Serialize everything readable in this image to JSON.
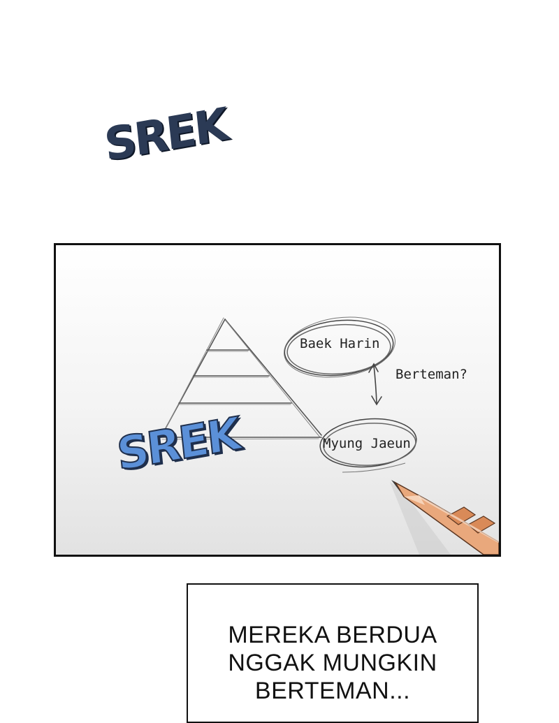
{
  "sfx": {
    "top": "SREK",
    "panel": "SREK"
  },
  "panel": {
    "labels": {
      "baek_harin": "Baek Harin",
      "myung_jaeun": "Myung Jaeun",
      "berteman": "Berteman?"
    },
    "pencil_color": "#e9a87c",
    "sfx_color": "#5b90d8"
  },
  "caption": {
    "line1": "MEREKA BERDUA",
    "line2": "NGGAK MUNGKIN",
    "line3": "BERTEMAN..."
  },
  "icons": [
    "pencil-icon",
    "pyramid-sketch",
    "double-arrow-icon"
  ]
}
